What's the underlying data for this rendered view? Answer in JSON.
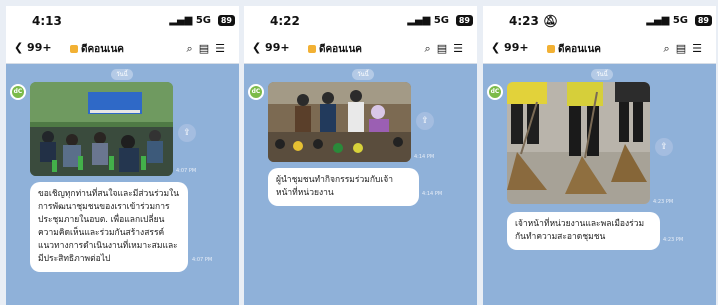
{
  "screens": [
    {
      "status": {
        "time": "4:13",
        "signal": "5G",
        "battery": "89"
      },
      "nav": {
        "back": "99+",
        "title": "ดีคอนเนค"
      },
      "day_label": "วันนี้",
      "photo_time": "4:07 PM",
      "message": "ขอเชิญทุกท่านที่สนใจและมีส่วนร่วมในการพัฒนาชุมชนของเราเข้าร่วมการประชุมภายในอบต. เพื่อแลกเปลี่ยนความคิดเห็นและร่วมกันสร้างสรรค์แนวทางการดำเนินงานที่เหมาะสมและมีประสิทธิภาพต่อไป",
      "message_time": "4:07 PM"
    },
    {
      "status": {
        "time": "4:22",
        "signal": "5G",
        "battery": "89"
      },
      "nav": {
        "back": "99+",
        "title": "ดีคอนเนค"
      },
      "day_label": "วันนี้",
      "photo_time": "4:14 PM",
      "message": "ผู้นำชุมชนทำกิจกรรมร่วมกับเจ้าหน้าที่หน่วยงาน",
      "message_time": "4:14 PM"
    },
    {
      "status": {
        "time": "4:23",
        "signal": "5G",
        "battery": "89"
      },
      "nav": {
        "back": "99+",
        "title": "ดีคอนเนค"
      },
      "day_label": "วันนี้",
      "photo_time": "4:23 PM",
      "message": "เจ้าหน้าที่หน่วยงานและพลเมืองร่วมกันทำความสะอาดชุมชน",
      "message_time": "4:23 PM"
    }
  ]
}
